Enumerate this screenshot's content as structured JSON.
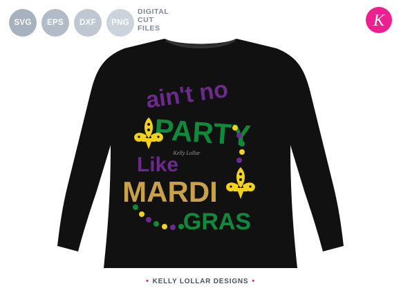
{
  "formats": [
    {
      "label": "SVG",
      "color": "#a7b2bf"
    },
    {
      "label": "EPS",
      "color": "#b2bcc8"
    },
    {
      "label": "DXF",
      "color": "#bfc8d2"
    },
    {
      "label": "PNG",
      "color": "#cbd3dc"
    }
  ],
  "digital_cut_files": {
    "line1": "DIGITAL",
    "line2": "CUT",
    "line3": "FILES"
  },
  "logo": {
    "letter": "K",
    "color": "#ee1f8f"
  },
  "shirt": {
    "color": "#111111",
    "design": {
      "line1": "ain't no",
      "line2": "PARTY",
      "line3": "Like",
      "line4": "MARDI",
      "line5": "GRAS",
      "watermark": "Kelly Lollar"
    },
    "colors": {
      "purple": "#6b2a8c",
      "green": "#0f8a3b",
      "gold": "#c9a14a",
      "yellow": "#f2d21c"
    }
  },
  "footer": {
    "text": "KELLY LOLLAR DESIGNS",
    "dot": "•"
  }
}
